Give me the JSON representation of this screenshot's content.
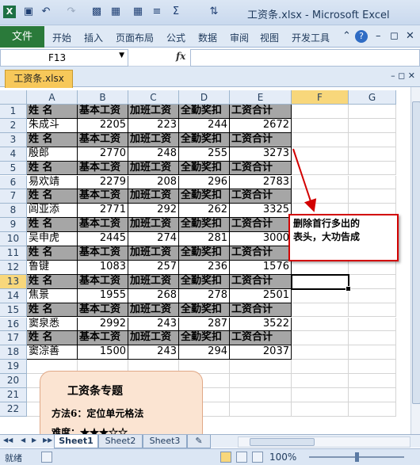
{
  "window": {
    "title": "工资条.xlsx - Microsoft Excel",
    "qat_icons": [
      "excel-logo-icon",
      "save-icon",
      "undo-icon",
      "redo-icon",
      "print-preview-icon",
      "format-painter-icon",
      "table-icon",
      "filter-icon",
      "sum-icon",
      "sort-icon"
    ]
  },
  "ribbon": {
    "file_label": "文件",
    "tabs": [
      "开始",
      "插入",
      "页面布局",
      "公式",
      "数据",
      "审阅",
      "视图",
      "开发工具"
    ]
  },
  "formula_bar": {
    "name_box": "F13",
    "fx": "fx",
    "value": ""
  },
  "document_tab": "工资条.xlsx",
  "columns": [
    "A",
    "B",
    "C",
    "D",
    "E",
    "F",
    "G"
  ],
  "rows": [
    "1",
    "2",
    "3",
    "4",
    "5",
    "6",
    "7",
    "8",
    "9",
    "10",
    "11",
    "12",
    "13",
    "14",
    "15",
    "16",
    "17",
    "18",
    "19",
    "20",
    "21",
    "22"
  ],
  "header_labels": [
    "姓  名",
    "基本工资",
    "加班工资",
    "全勤奖扣",
    "工资合计"
  ],
  "employees": [
    {
      "name": "朱成斗",
      "base": "2205",
      "overtime": "223",
      "attendance": "244",
      "total": "2672"
    },
    {
      "name": "殷郎",
      "base": "2770",
      "overtime": "248",
      "attendance": "255",
      "total": "3273"
    },
    {
      "name": "易欢靖",
      "base": "2279",
      "overtime": "208",
      "attendance": "296",
      "total": "2783"
    },
    {
      "name": "闾亚添",
      "base": "2771",
      "overtime": "292",
      "attendance": "262",
      "total": "3325"
    },
    {
      "name": "吴申虎",
      "base": "2445",
      "overtime": "274",
      "attendance": "281",
      "total": "3000"
    },
    {
      "name": "鲁键",
      "base": "1083",
      "overtime": "257",
      "attendance": "236",
      "total": "1576"
    },
    {
      "name": "焦景",
      "base": "1955",
      "overtime": "268",
      "attendance": "278",
      "total": "2501"
    },
    {
      "name": "窦泉悉",
      "base": "2992",
      "overtime": "243",
      "attendance": "287",
      "total": "3522"
    },
    {
      "name": "窦淙善",
      "base": "1500",
      "overtime": "243",
      "attendance": "294",
      "total": "2037"
    }
  ],
  "active_cell": "F13",
  "callout": {
    "line1": "删除首行多出的",
    "line2": "表头，大功告成"
  },
  "card": {
    "title": "工资条专题",
    "method": "方法6：定位单元格法",
    "difficulty": "难度：★★★☆☆"
  },
  "sheets": [
    "Sheet1",
    "Sheet2",
    "Sheet3"
  ],
  "active_sheet": "Sheet1",
  "status": {
    "ready": "就绪",
    "zoom": "100%"
  },
  "colors": {
    "header_fill": "#a6a6a6",
    "callout_border": "#d20000",
    "card_fill": "#fbe4d2",
    "file_tab": "#2a7a3a"
  }
}
